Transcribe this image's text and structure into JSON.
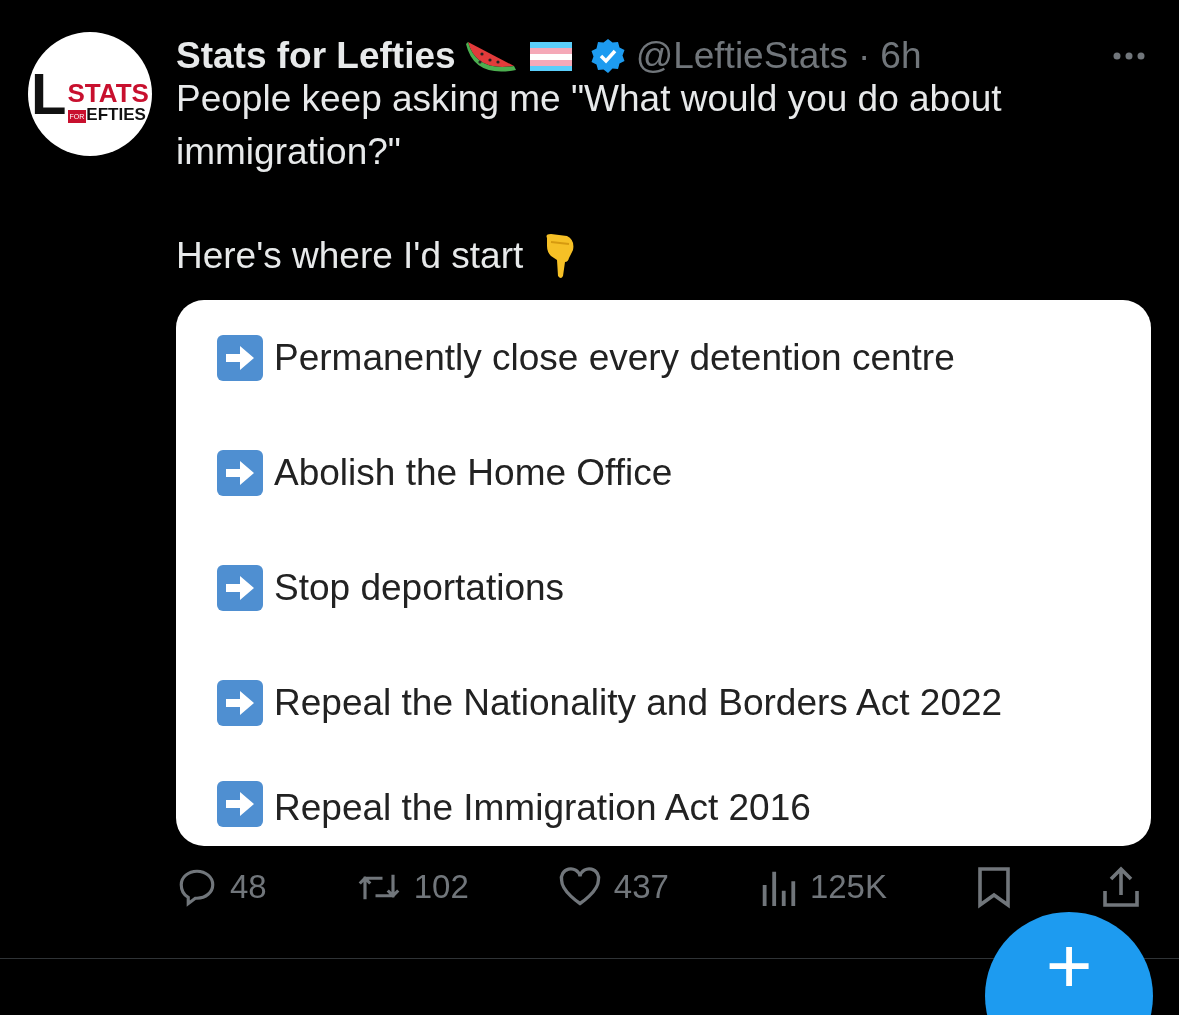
{
  "avatar": {
    "letter": "L",
    "top": "STATS",
    "tag": "FOR",
    "bottom": "EFTIES"
  },
  "author": {
    "name": "Stats for Lefties",
    "verified": true,
    "handle": "@LeftieStats",
    "separator": "·",
    "time": "6h"
  },
  "text": [
    "People keep asking me \"What would you do about immigration?\"",
    "Here's where I'd start"
  ],
  "items": [
    {
      "label": "Permanently close every detention centre"
    },
    {
      "label": "Abolish the Home Office"
    },
    {
      "label": "Stop deportations"
    },
    {
      "label": "Repeal the Nationality and Borders Act 2022"
    },
    {
      "label": "Repeal the Immigration Act 2016"
    }
  ],
  "actions": [
    {
      "kind": "reply",
      "count": "48"
    },
    {
      "kind": "retweet",
      "count": "102"
    },
    {
      "kind": "like",
      "count": "437"
    },
    {
      "kind": "views",
      "count": "125K"
    },
    {
      "kind": "bookmark"
    },
    {
      "kind": "share"
    }
  ],
  "compose": {
    "label": "+"
  }
}
